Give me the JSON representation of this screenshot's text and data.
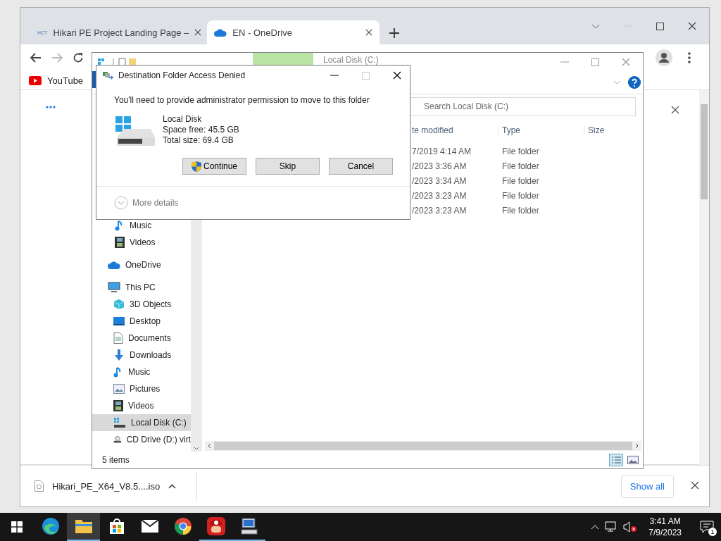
{
  "browser": {
    "tabs": [
      {
        "favicon": "HCT",
        "title": "Hikari PE Project Landing Page –",
        "selected": false
      },
      {
        "title": "EN - OneDrive",
        "selected": true
      }
    ],
    "bookmarks": [
      {
        "label": "YouTube"
      }
    ],
    "download": {
      "file": "Hikari_PE_X64_V8.5....iso",
      "show_all": "Show all"
    }
  },
  "explorer": {
    "title": "Local Disk (C:)",
    "search_placeholder": "Search Local Disk (C:)",
    "columns": [
      "te modified",
      "Type",
      "Size"
    ],
    "rows": [
      {
        "date": "7/2019 4:14 AM",
        "type": "File folder"
      },
      {
        "date": "/2023 3:36 AM",
        "type": "File folder"
      },
      {
        "date": "/2023 3:34 AM",
        "type": "File folder"
      },
      {
        "date": "/2023 3:23 AM",
        "type": "File folder"
      },
      {
        "date": "/2023 3:23 AM",
        "type": "File folder"
      }
    ],
    "quick_access": [
      {
        "label": "Music",
        "kind": "music",
        "selected": false
      },
      {
        "label": "Videos",
        "kind": "video",
        "selected": false
      }
    ],
    "nav": [
      {
        "label": "OneDrive",
        "kind": "cloud",
        "selected": false
      },
      {
        "label": "This PC",
        "kind": "pc",
        "selected": false,
        "children": [
          {
            "label": "3D Objects",
            "kind": "cube",
            "selected": false
          },
          {
            "label": "Desktop",
            "kind": "desktop",
            "selected": false
          },
          {
            "label": "Documents",
            "kind": "document",
            "selected": false
          },
          {
            "label": "Downloads",
            "kind": "download",
            "selected": false
          },
          {
            "label": "Music",
            "kind": "music",
            "selected": false
          },
          {
            "label": "Pictures",
            "kind": "picture",
            "selected": false
          },
          {
            "label": "Videos",
            "kind": "video",
            "selected": false
          },
          {
            "label": "Local Disk (C:)",
            "kind": "disk",
            "selected": true
          },
          {
            "label": "CD Drive (D:) virt",
            "kind": "cd",
            "selected": false
          }
        ]
      }
    ],
    "status": "5 items"
  },
  "dialog": {
    "title": "Destination Folder Access Denied",
    "message": "You'll need to provide administrator permission to move to this folder",
    "drive": {
      "name": "Local Disk",
      "free": "Space free: 45.5 GB",
      "total": "Total size: 69.4 GB"
    },
    "buttons": [
      {
        "label": "Continue",
        "kind": "uac"
      },
      {
        "label": "Skip",
        "kind": "plain"
      },
      {
        "label": "Cancel",
        "kind": "plain"
      }
    ],
    "more_details": "More details"
  },
  "taskbar": {
    "apps": [
      {
        "kind": "edge",
        "active": false,
        "running": false
      },
      {
        "kind": "explorer",
        "active": true,
        "running": true
      },
      {
        "kind": "store",
        "active": false,
        "running": false
      },
      {
        "kind": "mail",
        "active": false,
        "running": false
      },
      {
        "kind": "chrome",
        "active": false,
        "running": false
      },
      {
        "kind": "game",
        "active": false,
        "running": true
      },
      {
        "kind": "computer",
        "active": false,
        "running": true
      }
    ],
    "time": "3:41 AM",
    "date": "7/9/2023",
    "notifications": "1"
  }
}
